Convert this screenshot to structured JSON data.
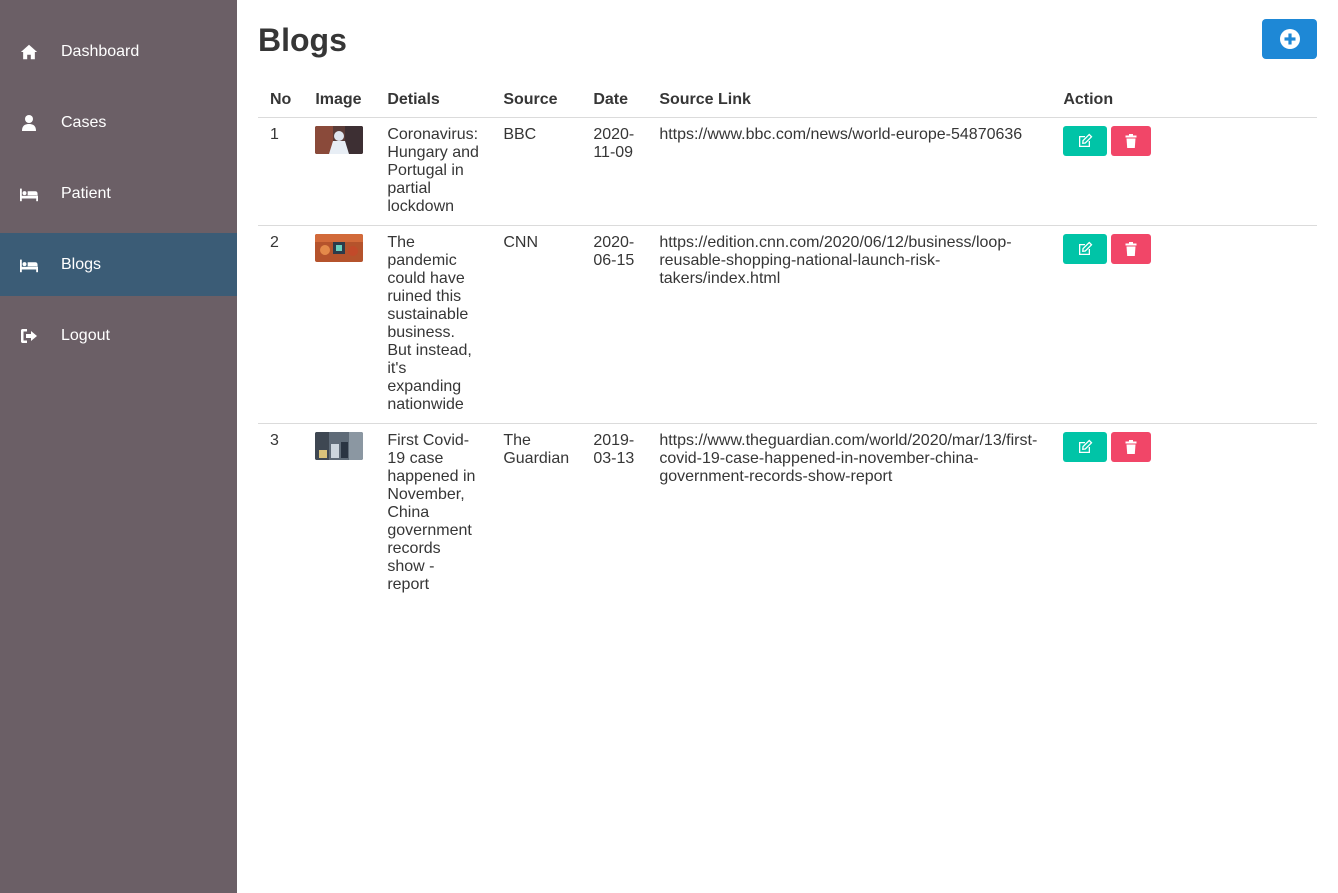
{
  "sidebar": {
    "items": [
      {
        "label": "Dashboard",
        "icon": "home-icon"
      },
      {
        "label": "Cases",
        "icon": "user-icon"
      },
      {
        "label": "Patient",
        "icon": "bed-icon"
      },
      {
        "label": "Blogs",
        "icon": "bed-icon",
        "active": true
      },
      {
        "label": "Logout",
        "icon": "sign-out-icon"
      }
    ]
  },
  "header": {
    "title": "Blogs",
    "add_icon": "plus-circle-icon"
  },
  "table": {
    "columns": [
      "No",
      "Image",
      "Detials",
      "Source",
      "Date",
      "Source Link",
      "Action"
    ],
    "rows": [
      {
        "no": "1",
        "details": "Coronavirus: Hungary and Portugal in partial lockdown",
        "source": "BBC",
        "date": "2020-11-09",
        "link": "https://www.bbc.com/news/world-europe-54870636"
      },
      {
        "no": "2",
        "details": "The pandemic could have ruined this sustainable business. But instead, it's expanding nationwide",
        "source": "CNN",
        "date": "2020-06-15",
        "link": "https://edition.cnn.com/2020/06/12/business/loop-reusable-shopping-national-launch-risk-takers/index.html"
      },
      {
        "no": "3",
        "details": "First Covid-19 case happened in November, China government records show - report",
        "source": "The Guardian",
        "date": "2019-03-13",
        "link": "https://www.theguardian.com/world/2020/mar/13/first-covid-19-case-happened-in-november-china-government-records-show-report"
      }
    ]
  },
  "colors": {
    "sidebar_bg": "#6b5f66",
    "sidebar_active": "#3b5c76",
    "primary": "#1e88d6",
    "edit": "#00c4a7",
    "delete": "#f14668"
  }
}
